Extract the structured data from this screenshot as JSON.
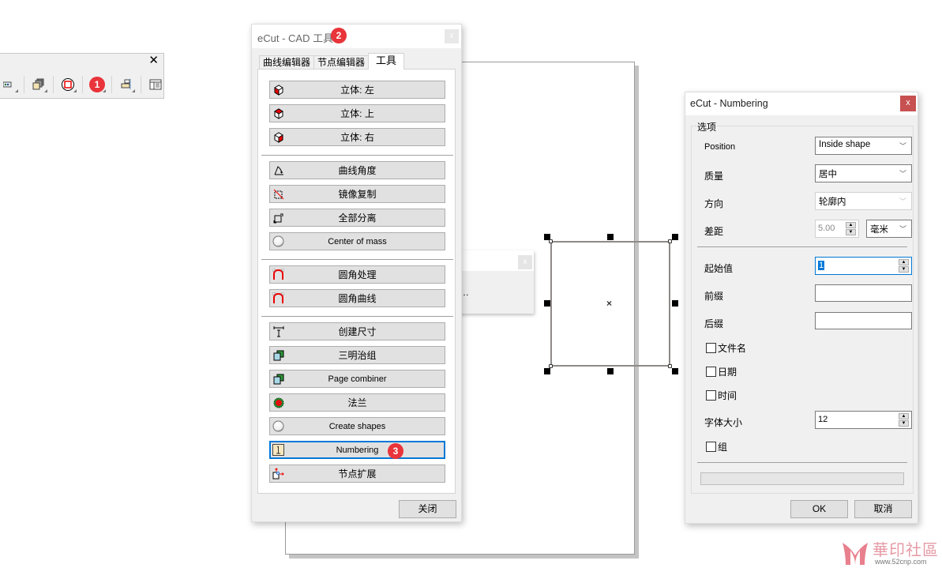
{
  "toolbar": {
    "close_label": "✕",
    "badge": "1",
    "buttons": [
      {
        "icon": "bitmap-tool-icon"
      },
      {
        "icon": "stacked-pages-icon"
      },
      {
        "icon": "red-target-icon"
      },
      {
        "icon": "ecut-tools-icon"
      },
      {
        "icon": "align-icon"
      },
      {
        "icon": "table-view-icon"
      }
    ]
  },
  "cad_dialog": {
    "title": "eCut - CAD 工具",
    "badge": "2",
    "close_label": "x",
    "tabs": [
      {
        "label": "曲线编辑器",
        "active": false
      },
      {
        "label": "节点编辑器",
        "active": false
      },
      {
        "label": "工具",
        "active": true
      }
    ],
    "tools": [
      {
        "label": "立体: 左",
        "icon": "cube-left-icon"
      },
      {
        "label": "立体: 上",
        "icon": "cube-top-icon"
      },
      {
        "label": "立体: 右",
        "icon": "cube-right-icon"
      },
      {
        "label": "曲线角度",
        "icon": "curve-angle-icon"
      },
      {
        "label": "镜像复制",
        "icon": "mirror-copy-icon"
      },
      {
        "label": "全部分离",
        "icon": "separate-all-icon"
      },
      {
        "label": "Center of mass",
        "icon": "center-mass-icon"
      },
      {
        "label": "圆角处理",
        "icon": "fillet-icon"
      },
      {
        "label": "圆角曲线",
        "icon": "fillet-curve-icon"
      },
      {
        "label": "创建尺寸",
        "icon": "dimension-icon"
      },
      {
        "label": "三明治组",
        "icon": "sandwich-group-icon"
      },
      {
        "label": "Page combiner",
        "icon": "page-combiner-icon"
      },
      {
        "label": "法兰",
        "icon": "flange-icon"
      },
      {
        "label": "Create shapes",
        "icon": "create-shapes-icon"
      },
      {
        "label": "Numbering",
        "icon": "numbering-icon",
        "badge": "3"
      },
      {
        "label": "节点扩展",
        "icon": "node-extend-icon"
      }
    ],
    "close_button": "关闭"
  },
  "ghost_dialog": {
    "close_label": "x",
    "text": "…"
  },
  "canvas": {
    "center_mark": "×"
  },
  "numbering_dialog": {
    "title": "eCut - Numbering",
    "close_label": "x",
    "group_title": "选项",
    "fields": {
      "position": {
        "label": "Position",
        "value": "Inside shape"
      },
      "quality": {
        "label": "质量",
        "value": "居中"
      },
      "direction": {
        "label": "方向",
        "value": "轮廓内",
        "disabled": true
      },
      "offset": {
        "label": "差距",
        "value": "5.00",
        "unit": "毫米"
      },
      "start_value": {
        "label": "起始值",
        "value": "1"
      },
      "prefix": {
        "label": "前缀",
        "value": ""
      },
      "suffix": {
        "label": "后缀",
        "value": ""
      },
      "font_size": {
        "label": "字体大小",
        "value": "12"
      }
    },
    "checkboxes": [
      {
        "label": "文件名",
        "checked": false
      },
      {
        "label": "日期",
        "checked": false
      },
      {
        "label": "时间",
        "checked": false
      }
    ],
    "group_checkbox": {
      "label": "组",
      "checked": false
    },
    "progress": 0,
    "ok_button": "OK",
    "cancel_button": "取消"
  },
  "watermark": {
    "name": "華印社區",
    "url": "www.52cnp.com"
  }
}
